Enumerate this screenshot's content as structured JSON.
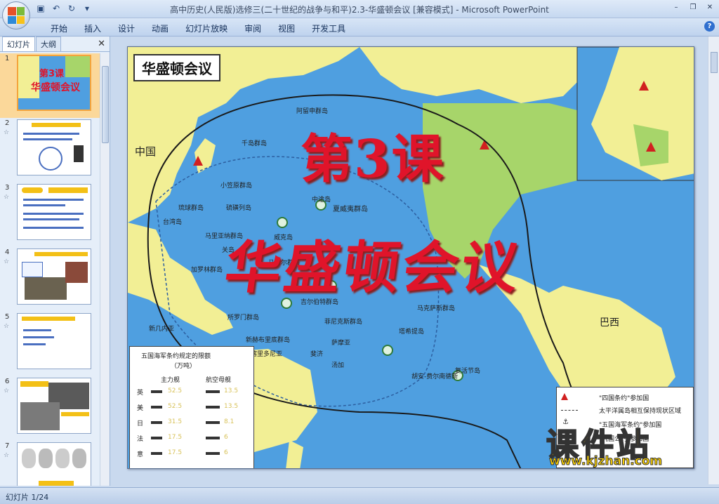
{
  "window": {
    "title": "高中历史(人民版)选修三(二十世纪的战争与和平)2.3-华盛顿会议 [兼容模式] - Microsoft PowerPoint",
    "minimize": "–",
    "restore": "❐",
    "close": "✕"
  },
  "ribbon": {
    "tabs": [
      "开始",
      "插入",
      "设计",
      "动画",
      "幻灯片放映",
      "审阅",
      "视图",
      "开发工具"
    ]
  },
  "panel": {
    "tab_slides": "幻灯片",
    "tab_outline": "大纲",
    "close": "✕",
    "thumbnails": [
      {
        "num": "1",
        "star": ""
      },
      {
        "num": "2",
        "star": "☆"
      },
      {
        "num": "3",
        "star": "☆"
      },
      {
        "num": "4",
        "star": "☆"
      },
      {
        "num": "5",
        "star": "☆"
      },
      {
        "num": "6",
        "star": "☆"
      },
      {
        "num": "7",
        "star": "☆"
      }
    ]
  },
  "slide": {
    "map_title": "华盛顿会议",
    "lesson": "第3课",
    "headline": "华盛顿会议",
    "map_labels": {
      "china": "中国",
      "aleutian": "阿留申群岛",
      "kuril": "千岛群岛",
      "bonin": "小笠原群岛",
      "ryukyu": "琉球群岛",
      "taiwan": "台湾岛",
      "volcano": "硫磺列岛",
      "marianas": "马里亚纳群岛",
      "midway": "中途岛",
      "hawaii": "夏威夷群岛",
      "guam": "关岛",
      "marshall": "马绍尔群岛",
      "wake": "威克岛",
      "gilbert": "吉尔伯特群岛",
      "caroline": "加罗林群岛",
      "phoenix": "菲尼克斯群岛",
      "samoa": "萨摩亚",
      "fiji": "斐济",
      "tonga": "汤加",
      "marquesas": "马克萨斯群岛",
      "tahiti": "塔希提岛",
      "new_guinea": "新几内亚",
      "solomon": "所罗门群岛",
      "new_hebrides": "新赫布里底群岛",
      "new_caledonia": "新喀里多尼亚",
      "easter": "复活节岛",
      "juan": "胡安-费尔南德斯",
      "brazil": "巴西"
    },
    "table": {
      "title": "五国海军条约规定的限额",
      "subtitle": "（万吨）",
      "col1": "主力舰",
      "col2": "航空母舰",
      "rows": [
        {
          "country": "英",
          "capital": "52.5",
          "carrier": "13.5"
        },
        {
          "country": "美",
          "capital": "52.5",
          "carrier": "13.5"
        },
        {
          "country": "日",
          "capital": "31.5",
          "carrier": "8.1"
        },
        {
          "country": "法",
          "capital": "17.5",
          "carrier": "6"
        },
        {
          "country": "意",
          "capital": "17.5",
          "carrier": "6"
        }
      ]
    },
    "legend": {
      "item1": "\"四国条约\"参加国",
      "item2": "太平洋属岛相互保持现状区域",
      "item3": "\"五国海军条约\"参加国",
      "item4": "\"九国公约\"参加国"
    }
  },
  "watermark": {
    "main": "课件站",
    "url": "www.kjzhan.com"
  },
  "status": {
    "slide_counter": "幻灯片 1/24"
  },
  "colors": {
    "ocean": "#4f9fe0",
    "land": "#f2ef95",
    "accent_red": "#e0142a",
    "watermark_yellow": "#ffd400"
  }
}
